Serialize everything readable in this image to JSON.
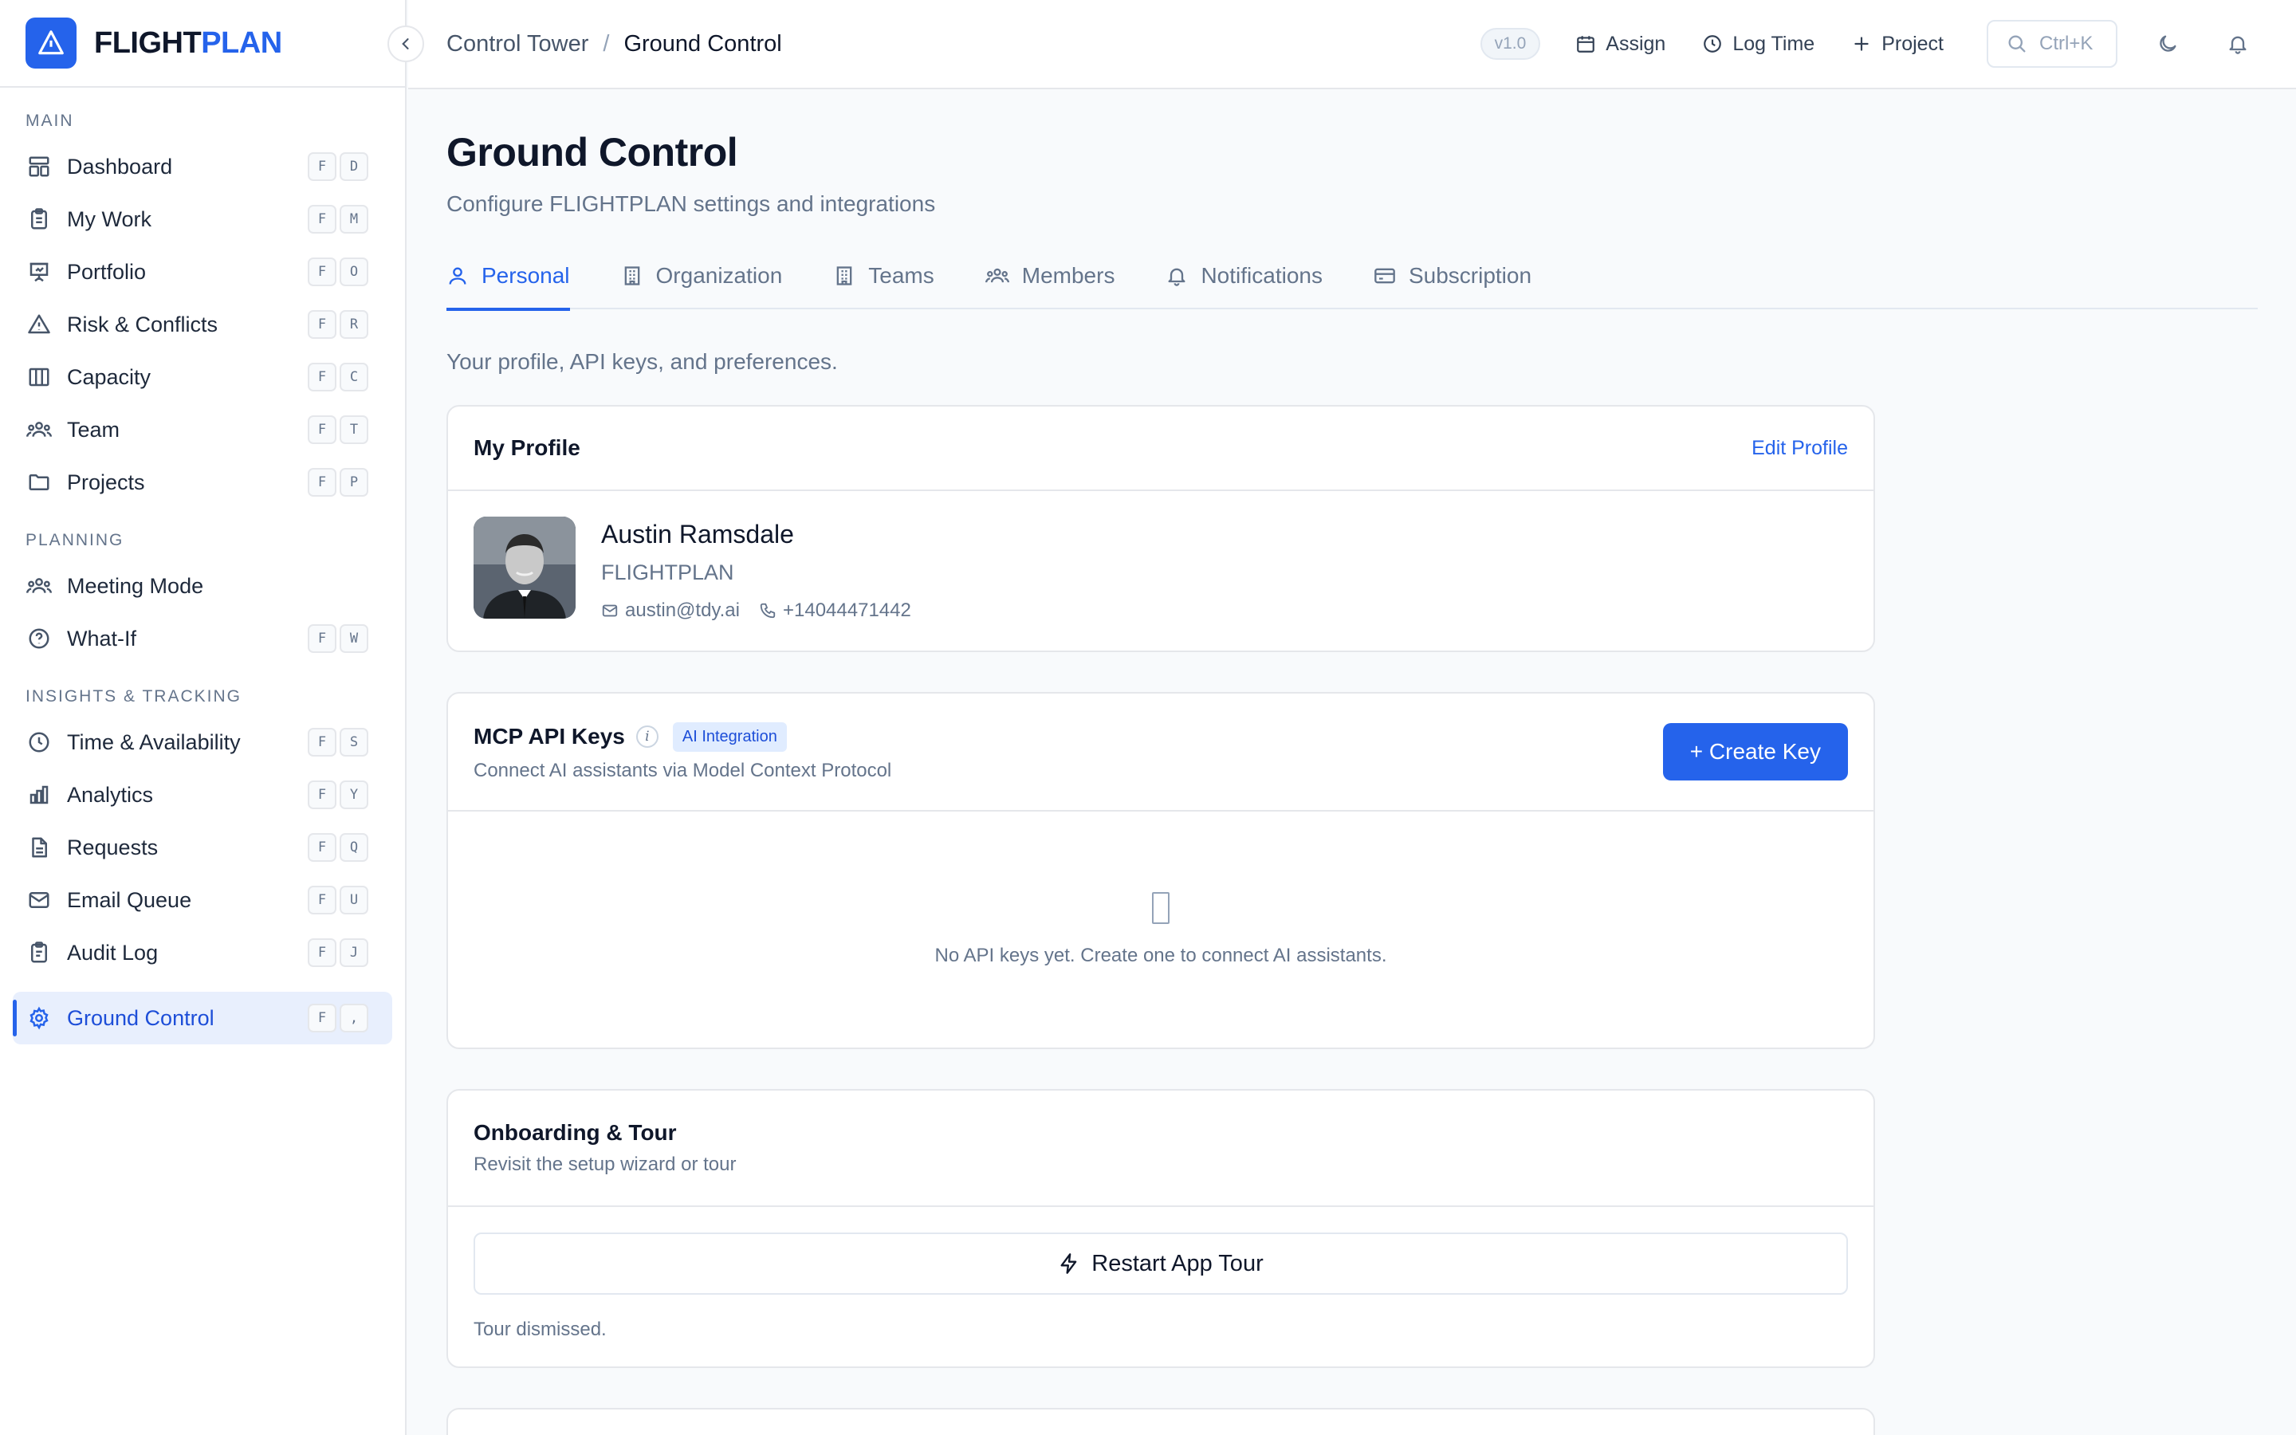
{
  "brand": {
    "name_part1": "FLIGHT",
    "name_part2": "PLAN"
  },
  "colors": {
    "accent": "#2563eb",
    "active_bg": "#e8effd",
    "text": "#0f172a",
    "muted": "#64748b"
  },
  "sidebar": {
    "sections": [
      {
        "title": "MAIN",
        "items": [
          {
            "label": "Dashboard",
            "icon": "dashboard-icon",
            "keys": [
              "F",
              "D"
            ]
          },
          {
            "label": "My Work",
            "icon": "clipboard-icon",
            "keys": [
              "F",
              "M"
            ]
          },
          {
            "label": "Portfolio",
            "icon": "presentation-icon",
            "keys": [
              "F",
              "O"
            ]
          },
          {
            "label": "Risk & Conflicts",
            "icon": "warning-icon",
            "keys": [
              "F",
              "R"
            ]
          },
          {
            "label": "Capacity",
            "icon": "columns-icon",
            "keys": [
              "F",
              "C"
            ]
          },
          {
            "label": "Team",
            "icon": "users-icon",
            "keys": [
              "F",
              "T"
            ]
          },
          {
            "label": "Projects",
            "icon": "folder-icon",
            "keys": [
              "F",
              "P"
            ]
          }
        ]
      },
      {
        "title": "PLANNING",
        "items": [
          {
            "label": "Meeting Mode",
            "icon": "users-icon",
            "keys": []
          },
          {
            "label": "What-If",
            "icon": "help-circle-icon",
            "keys": [
              "F",
              "W"
            ]
          }
        ]
      },
      {
        "title": "INSIGHTS & TRACKING",
        "items": [
          {
            "label": "Time & Availability",
            "icon": "clock-icon",
            "keys": [
              "F",
              "S"
            ]
          },
          {
            "label": "Analytics",
            "icon": "bar-chart-icon",
            "keys": [
              "F",
              "Y"
            ]
          },
          {
            "label": "Requests",
            "icon": "document-icon",
            "keys": [
              "F",
              "Q"
            ]
          },
          {
            "label": "Email Queue",
            "icon": "mail-icon",
            "keys": [
              "F",
              "U"
            ]
          },
          {
            "label": "Audit Log",
            "icon": "clipboard-list-icon",
            "keys": [
              "F",
              "J"
            ]
          }
        ]
      }
    ],
    "active_item": {
      "label": "Ground Control",
      "icon": "gear-icon",
      "keys": [
        "F",
        ","
      ]
    }
  },
  "topbar": {
    "breadcrumb_parent": "Control Tower",
    "breadcrumb_sep": "/",
    "breadcrumb_current": "Ground Control",
    "version": "v1.0",
    "assign_label": "Assign",
    "log_time_label": "Log Time",
    "project_label": "Project",
    "search_shortcut": "Ctrl+K"
  },
  "page": {
    "title": "Ground Control",
    "subtitle": "Configure FLIGHTPLAN settings and integrations",
    "tabs": [
      {
        "label": "Personal",
        "icon": "user-icon",
        "active": true
      },
      {
        "label": "Organization",
        "icon": "building-icon",
        "active": false
      },
      {
        "label": "Teams",
        "icon": "building-icon",
        "active": false
      },
      {
        "label": "Members",
        "icon": "users-icon",
        "active": false
      },
      {
        "label": "Notifications",
        "icon": "bell-icon",
        "active": false
      },
      {
        "label": "Subscription",
        "icon": "credit-card-icon",
        "active": false
      }
    ],
    "tab_description": "Your profile, API keys, and preferences."
  },
  "profile": {
    "card_title": "My Profile",
    "edit_label": "Edit Profile",
    "name": "Austin Ramsdale",
    "org": "FLIGHTPLAN",
    "email": "austin@tdy.ai",
    "phone": "+14044471442"
  },
  "api_keys": {
    "title": "MCP API Keys",
    "info_glyph": "i",
    "badge": "AI Integration",
    "subtitle": "Connect AI assistants via Model Context Protocol",
    "create_label": "+ Create Key",
    "empty_text": "No API keys yet. Create one to connect AI assistants."
  },
  "onboarding": {
    "title": "Onboarding & Tour",
    "subtitle": "Revisit the setup wizard or tour",
    "restart_label": "Restart App Tour",
    "status": "Tour dismissed."
  }
}
